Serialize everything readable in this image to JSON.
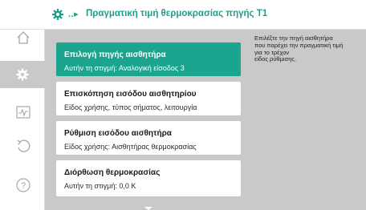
{
  "header": {
    "breadcrumb": "..▸",
    "title": "Πραγματική τιμή θερμοκρασίας πηγής T1"
  },
  "sidebar": {
    "items": [
      {
        "icon": "home-icon"
      },
      {
        "icon": "settings-gear-icon",
        "active": true
      },
      {
        "icon": "diagnostics-icon"
      },
      {
        "icon": "undo-icon"
      },
      {
        "icon": "help-icon"
      }
    ]
  },
  "menu": {
    "items": [
      {
        "title": "Επιλογή πηγής αισθητήρα",
        "subtitle": "Αυτήν τη στιγμή: Αναλογική είσοδος 3",
        "selected": true
      },
      {
        "title": "Επισκόπηση εισόδου αισθητηρίου",
        "subtitle": "Είδος χρήσης, τύπος σήματος, λειτουργία"
      },
      {
        "title": "Ρύθμιση εισόδου αισθητήρα",
        "subtitle": "Είδος χρήσης: Αισθητήρας θερμοκρασίας"
      },
      {
        "title": "Διόρθωση θερμοκρασίας",
        "subtitle": "Αυτήν τη στιγμή: 0,0 K"
      }
    ]
  },
  "help_text": {
    "lines": [
      "Επιλέξτε την πηγή αισθητήρα",
      "που παρέχει την πραγματική τιμή",
      "για το τρέχον",
      "είδος ρύθμισης."
    ]
  },
  "colors": {
    "accent": "#1ba58e",
    "header_text": "#1e9e8a",
    "background": "#c9c9c9"
  }
}
